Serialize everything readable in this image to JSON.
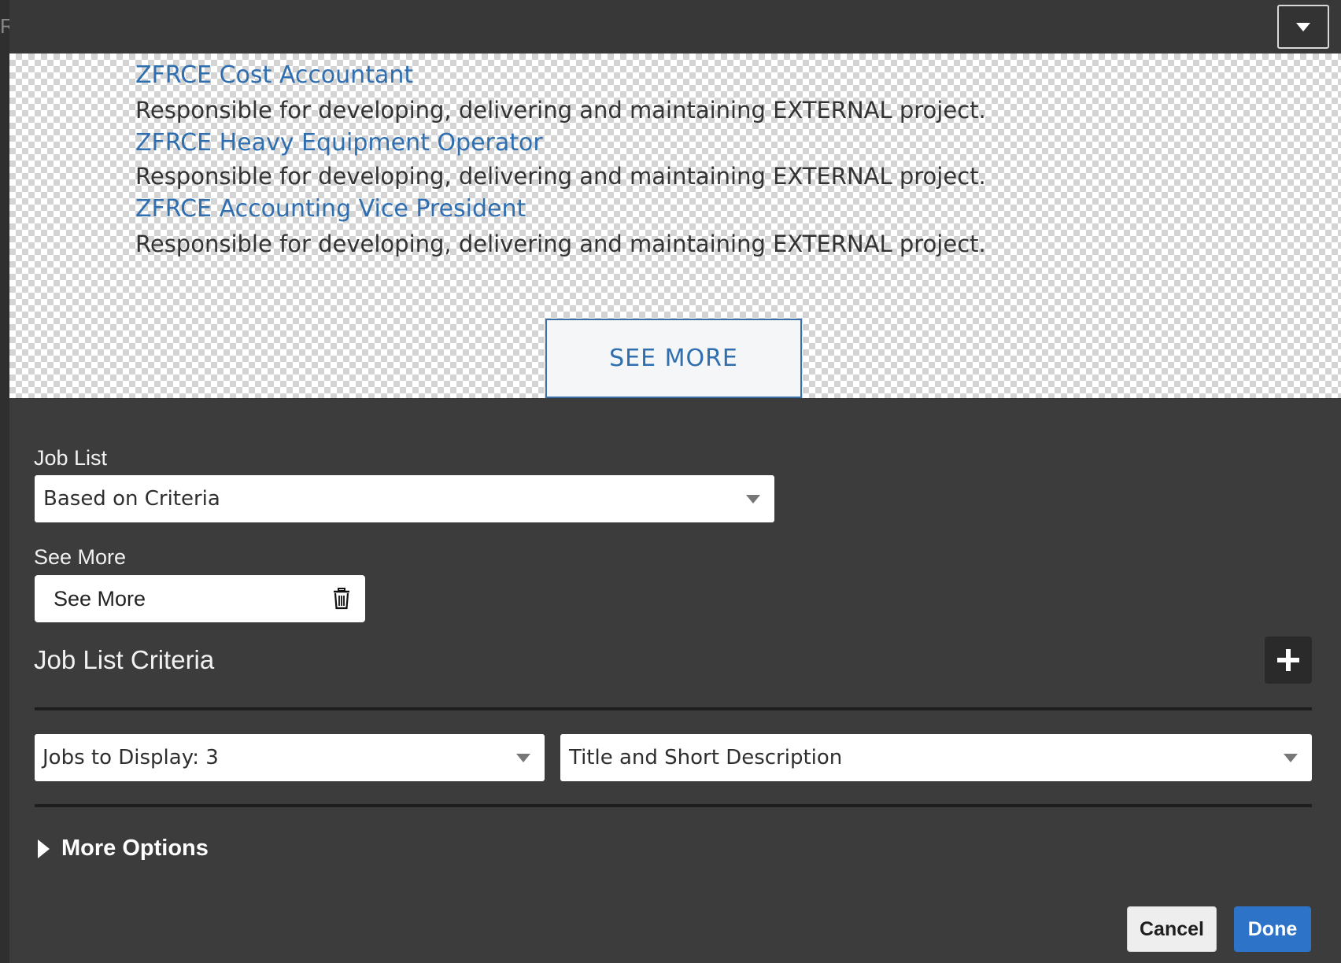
{
  "background": {
    "edge_text": "R"
  },
  "preview": {
    "jobs": [
      {
        "title": "ZFRCE Cost Accountant",
        "description": "Responsible for developing, delivering and maintaining EXTERNAL project."
      },
      {
        "title": "ZFRCE Heavy Equipment Operator",
        "description": "Responsible for developing, delivering and maintaining EXTERNAL project."
      },
      {
        "title": "ZFRCE Accounting Vice President",
        "description": "Responsible for developing, delivering and maintaining EXTERNAL project."
      }
    ],
    "see_more_label": "SEE MORE"
  },
  "settings": {
    "job_list": {
      "label": "Job List",
      "value": "Based on Criteria"
    },
    "see_more": {
      "label": "See More",
      "value": "See More"
    },
    "criteria": {
      "title": "Job List Criteria",
      "jobs_to_display": "Jobs to Display: 3",
      "display_format": "Title and Short Description"
    },
    "more_options_label": "More Options"
  },
  "footer": {
    "cancel_label": "Cancel",
    "done_label": "Done"
  },
  "colors": {
    "link": "#2f6fb0",
    "primary_button": "#2d74c9",
    "panel": "#3c3c3c"
  },
  "icons": [
    "chevron-down-icon",
    "trash-icon",
    "plus-icon",
    "caret-right-icon"
  ]
}
